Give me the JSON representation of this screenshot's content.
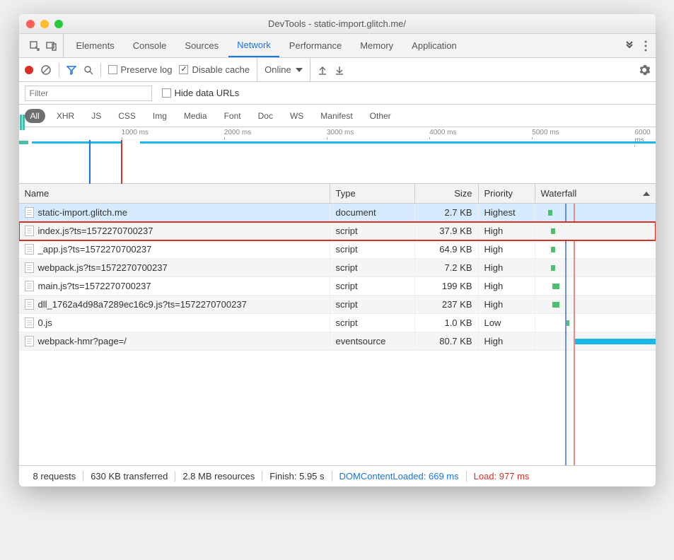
{
  "window": {
    "title": "DevTools - static-import.glitch.me/"
  },
  "tabs": {
    "items": [
      "Elements",
      "Console",
      "Sources",
      "Network",
      "Performance",
      "Memory",
      "Application"
    ],
    "active": "Network"
  },
  "toolbar": {
    "preserve_log": "Preserve log",
    "disable_cache": "Disable cache",
    "throttling": "Online"
  },
  "filterbar": {
    "filter_placeholder": "Filter",
    "hide_data_urls": "Hide data URLs"
  },
  "types": {
    "items": [
      "All",
      "XHR",
      "JS",
      "CSS",
      "Img",
      "Media",
      "Font",
      "Doc",
      "WS",
      "Manifest",
      "Other"
    ],
    "active": "All"
  },
  "timeline": {
    "ticks": [
      "1000 ms",
      "2000 ms",
      "3000 ms",
      "4000 ms",
      "5000 ms",
      "6000 ms"
    ]
  },
  "grid": {
    "headers": {
      "name": "Name",
      "type": "Type",
      "size": "Size",
      "priority": "Priority",
      "waterfall": "Waterfall"
    },
    "rows": [
      {
        "name": "static-import.glitch.me",
        "type": "document",
        "size": "2.7 KB",
        "priority": "Highest",
        "wf": {
          "start": 18,
          "width": 6,
          "color": "green"
        },
        "selected": true
      },
      {
        "name": "index.js?ts=1572270700237",
        "type": "script",
        "size": "37.9 KB",
        "priority": "High",
        "wf": {
          "start": 22,
          "width": 6,
          "color": "green"
        },
        "highlighted": true
      },
      {
        "name": "_app.js?ts=1572270700237",
        "type": "script",
        "size": "64.9 KB",
        "priority": "High",
        "wf": {
          "start": 22,
          "width": 6,
          "color": "green"
        }
      },
      {
        "name": "webpack.js?ts=1572270700237",
        "type": "script",
        "size": "7.2 KB",
        "priority": "High",
        "wf": {
          "start": 22,
          "width": 6,
          "color": "green"
        }
      },
      {
        "name": "main.js?ts=1572270700237",
        "type": "script",
        "size": "199 KB",
        "priority": "High",
        "wf": {
          "start": 24,
          "width": 10,
          "color": "green"
        }
      },
      {
        "name": "dll_1762a4d98a7289ec16c9.js?ts=1572270700237",
        "type": "script",
        "size": "237 KB",
        "priority": "High",
        "wf": {
          "start": 24,
          "width": 10,
          "color": "green"
        }
      },
      {
        "name": "0.js",
        "type": "script",
        "size": "1.0 KB",
        "priority": "Low",
        "wf": {
          "start": 44,
          "width": 4,
          "color": "green"
        }
      },
      {
        "name": "webpack-hmr?page=/",
        "type": "eventsource",
        "size": "80.7 KB",
        "priority": "High",
        "wf": {
          "start": 56,
          "width": 114,
          "color": "sky"
        }
      }
    ]
  },
  "status": {
    "requests": "8 requests",
    "transferred": "630 KB transferred",
    "resources": "2.8 MB resources",
    "finish": "Finish: 5.95 s",
    "dcl": "DOMContentLoaded: 669 ms",
    "load": "Load: 977 ms"
  }
}
